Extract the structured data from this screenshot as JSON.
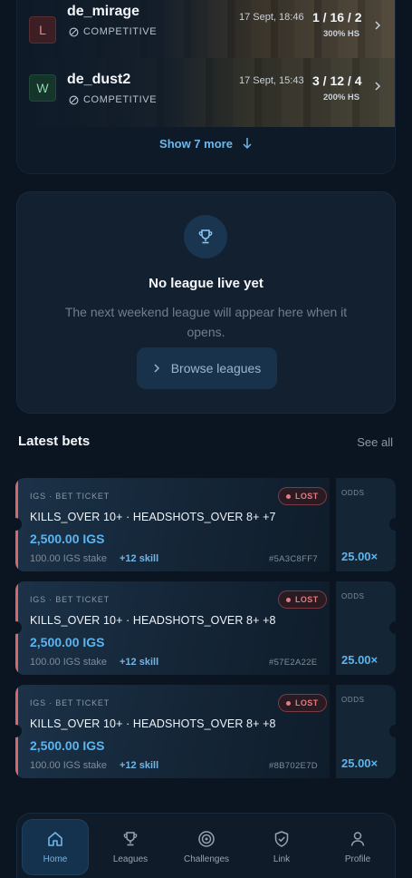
{
  "matches": [
    {
      "result": "L",
      "map": "de_mirage",
      "mode": "COMPETITIVE",
      "date": "17 Sept, 18:46",
      "kda": "1 / 16 / 2",
      "hs": "300% HS"
    },
    {
      "result": "W",
      "map": "de_dust2",
      "mode": "COMPETITIVE",
      "date": "17 Sept, 15:43",
      "kda": "3 / 12 / 4",
      "hs": "200% HS"
    }
  ],
  "show_more": "Show 7 more",
  "league": {
    "title": "No league live yet",
    "description": "The next weekend league will appear here when it opens.",
    "button": "Browse leagues"
  },
  "bets_section": {
    "title": "Latest bets",
    "see_all": "See all"
  },
  "bets": [
    {
      "label": "IGS · BET TICKET",
      "status": "LOST",
      "markets": "KILLS_OVER 10+ · HEADSHOTS_OVER 8+ +7",
      "payout": "2,500.00 IGS",
      "stake": "100.00 IGS stake",
      "skill": "+12 skill",
      "id": "#5A3C8FF7",
      "odds_label": "ODDS",
      "odds": "25.00×"
    },
    {
      "label": "IGS · BET TICKET",
      "status": "LOST",
      "markets": "KILLS_OVER 10+ · HEADSHOTS_OVER 8+ +8",
      "payout": "2,500.00 IGS",
      "stake": "100.00 IGS stake",
      "skill": "+12 skill",
      "id": "#57E2A22E",
      "odds_label": "ODDS",
      "odds": "25.00×"
    },
    {
      "label": "IGS · BET TICKET",
      "status": "LOST",
      "markets": "KILLS_OVER 10+ · HEADSHOTS_OVER 8+ +8",
      "payout": "2,500.00 IGS",
      "stake": "100.00 IGS stake",
      "skill": "+12 skill",
      "id": "#8B702E7D",
      "odds_label": "ODDS",
      "odds": "25.00×"
    }
  ],
  "nav": [
    {
      "label": "Home",
      "icon": "home-icon",
      "active": true
    },
    {
      "label": "Leagues",
      "icon": "trophy-icon",
      "active": false
    },
    {
      "label": "Challenges",
      "icon": "target-icon",
      "active": false
    },
    {
      "label": "Link",
      "icon": "shield-check-icon",
      "active": false
    },
    {
      "label": "Profile",
      "icon": "user-icon",
      "active": false
    }
  ],
  "colors": {
    "accent": "#5cb4f0",
    "lost": "#e27c83",
    "background": "#0b1522"
  }
}
